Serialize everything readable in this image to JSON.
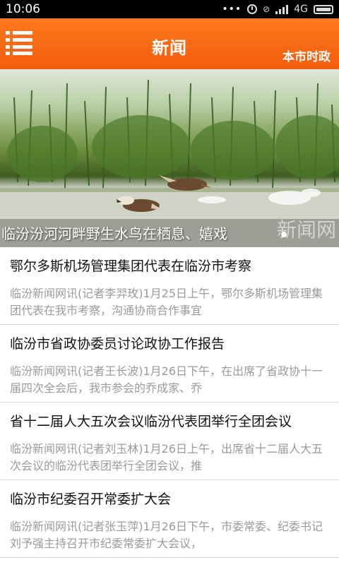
{
  "status_bar": {
    "time": "10:06",
    "network": "4G",
    "icons": [
      "more-dots-icon",
      "alarm-icon",
      "mute-icon",
      "signal-icon",
      "battery-icon"
    ]
  },
  "header": {
    "title": "新闻",
    "right_link": "本市时政",
    "menu_icon": "menu-list-icon",
    "color": "#f66a14"
  },
  "banner": {
    "caption": "临汾汾河河畔野生水鸟在栖息、嬉戏",
    "watermark": "新闻网",
    "active_slide": 1
  },
  "news": [
    {
      "title": "鄂尔多斯机场管理集团代表在临汾市考察",
      "summary": "临汾新闻网讯(记者李羿玫)1月25日上午，鄂尔多斯机场管理集团代表在我市考察，沟通协商合作事宜"
    },
    {
      "title": "临汾市省政协委员讨论政协工作报告",
      "summary": "临汾新闻网讯(记者王长波)1月26日下午，在出席了省政协十一届四次全会后，我市参会的乔成家、乔"
    },
    {
      "title": "省十二届人大五次会议临汾代表团举行全团会议",
      "summary": "临汾新闻网讯(记者刘玉林)1月26日上午，出席省十二届人大五次会议的临汾代表团举行全团会议，推"
    },
    {
      "title": "临汾市纪委召开常委扩大会",
      "summary": "临汾新闻网讯(记者张玉萍)1月26日下午，市委常委、纪委书记刘予强主持召开市纪委常委扩大会议，"
    }
  ]
}
